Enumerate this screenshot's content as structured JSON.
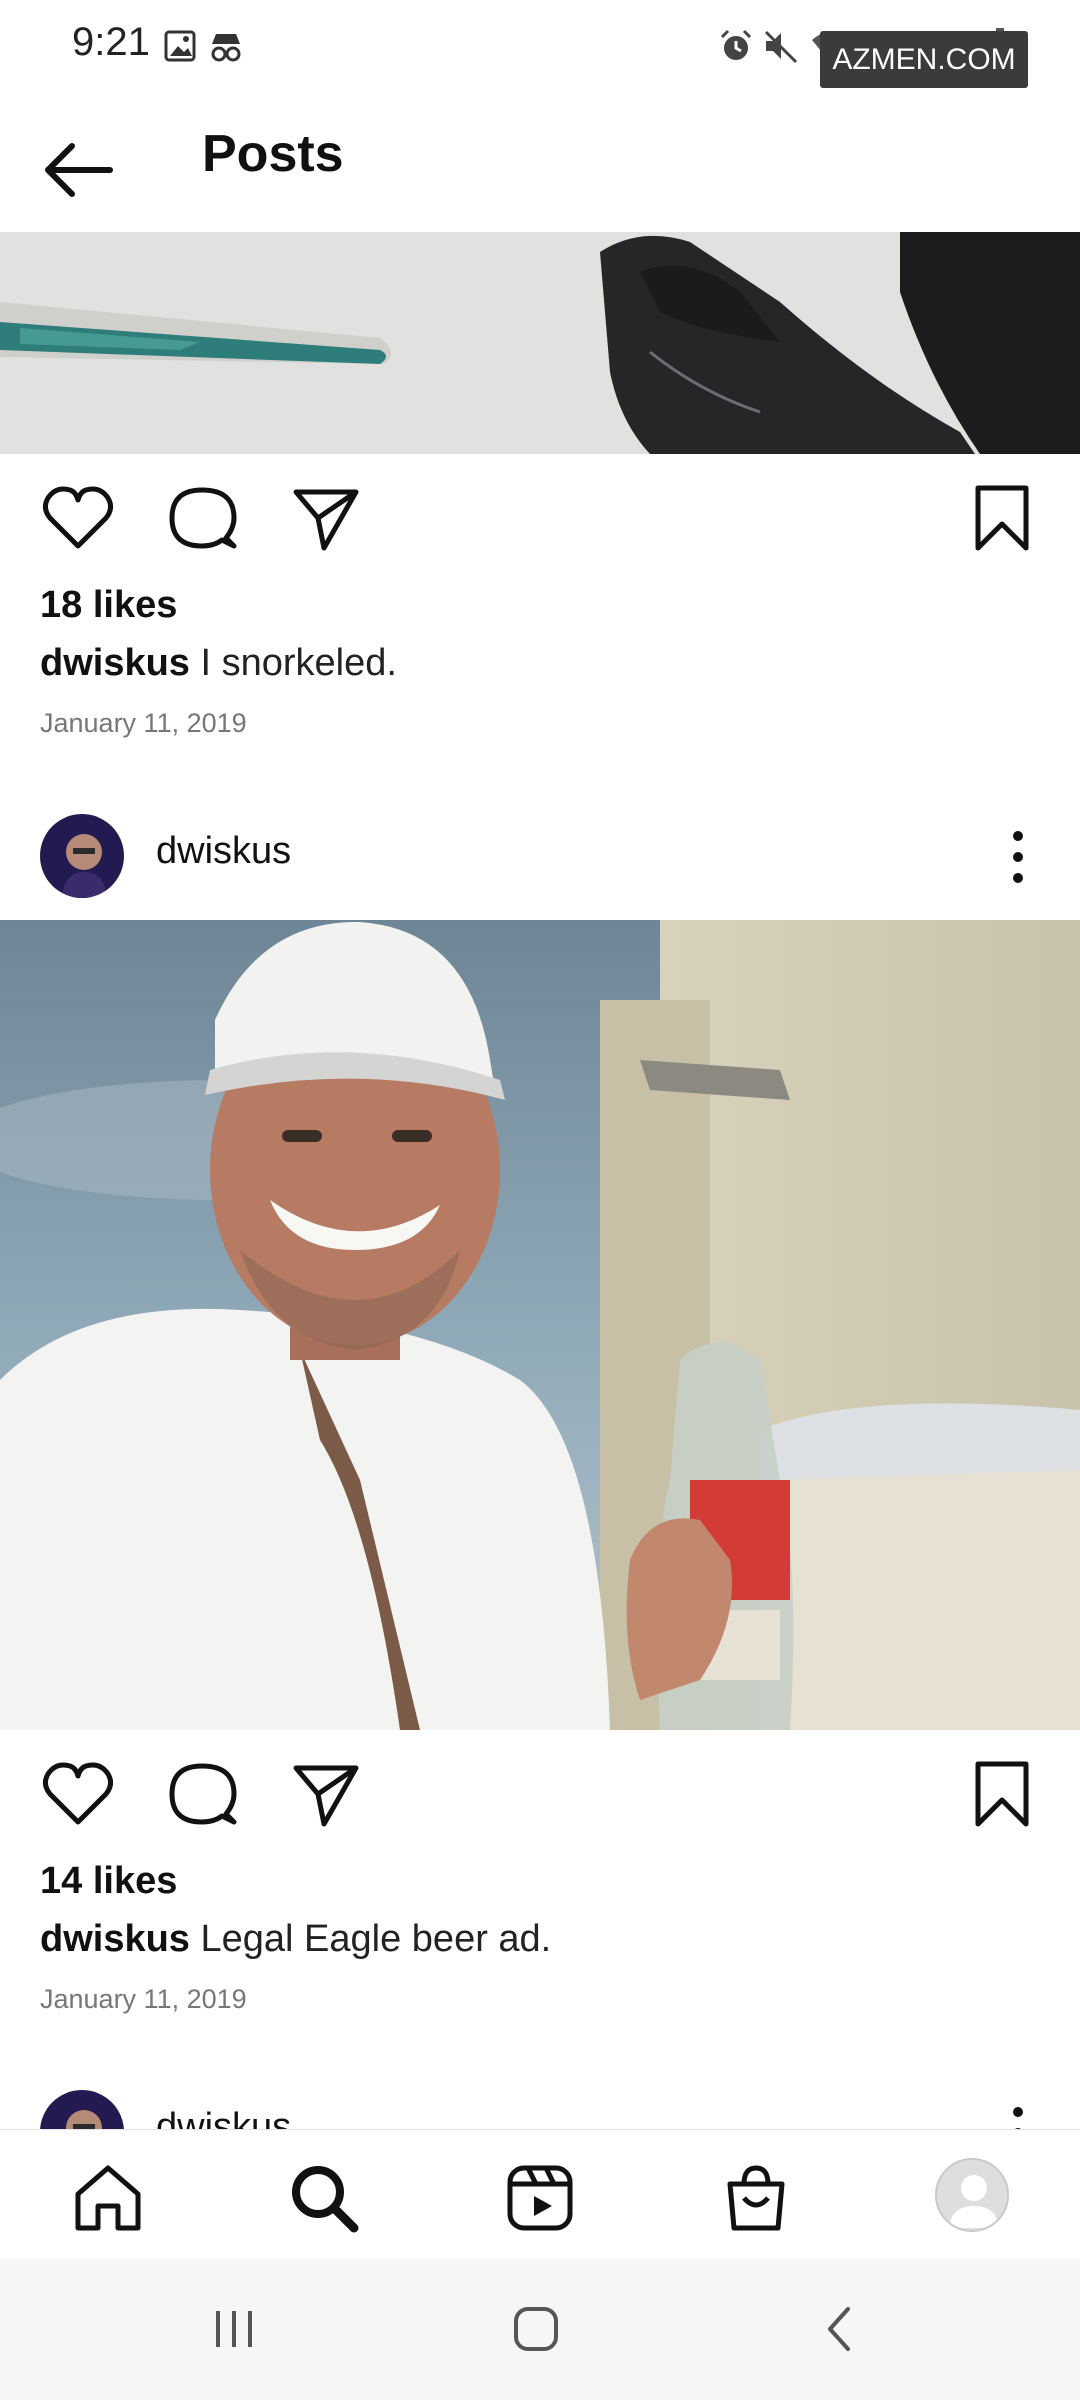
{
  "status_bar": {
    "time": "9:21",
    "left_icons": [
      "image-icon",
      "incognito-icon"
    ],
    "right_icons": [
      "alarm-icon",
      "mute-icon",
      "wifi-icon",
      "signal-icon",
      "battery-icon"
    ],
    "watermark": "AZMEN.COM"
  },
  "header": {
    "back_icon": "arrow-left-icon",
    "title": "Posts"
  },
  "posts": [
    {
      "media": "Photo of a white boat deck with a black diving fin",
      "actions": [
        "heart-icon",
        "comment-icon",
        "share-icon",
        "bookmark-icon"
      ],
      "likes": "18 likes",
      "username": "dwiskus",
      "caption": "I snorkeled.",
      "date": "January 11, 2019"
    },
    {
      "author": "dwiskus",
      "media": "Photo of a smiling man in a white cap holding a beer bottle on a boat",
      "actions": [
        "heart-icon",
        "comment-icon",
        "share-icon",
        "bookmark-icon"
      ],
      "likes": "14 likes",
      "username": "dwiskus",
      "caption": "Legal Eagle beer ad.",
      "date": "January 11, 2019"
    },
    {
      "author": "dwiskus"
    }
  ],
  "bottom_nav": [
    "home-icon",
    "search-icon",
    "reels-icon",
    "shop-icon",
    "profile-avatar"
  ],
  "system_nav": [
    "recents-icon",
    "home-button-icon",
    "back-icon"
  ],
  "colors": {
    "text": "#111111",
    "muted": "#777777",
    "nav_background": "#f6f6f6"
  }
}
